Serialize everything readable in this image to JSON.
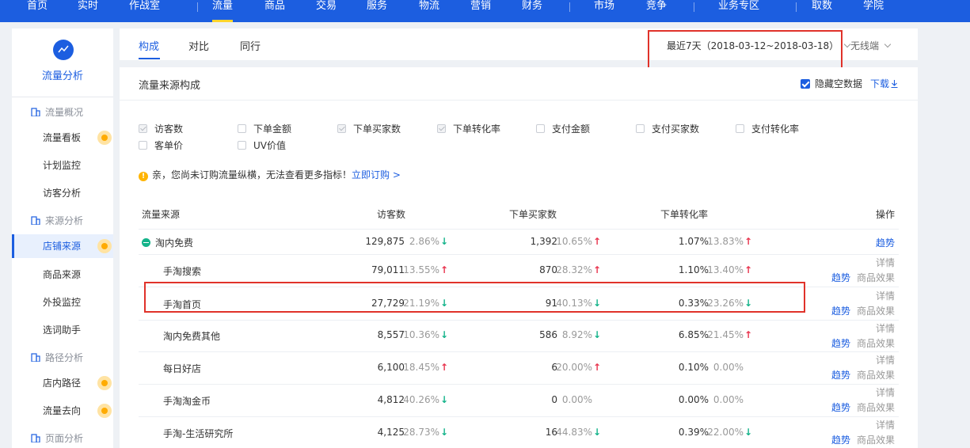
{
  "topnav": {
    "items": [
      "首页",
      "实时",
      "作战室",
      "流量",
      "商品",
      "交易",
      "服务",
      "物流",
      "营销",
      "财务",
      "市场",
      "竞争",
      "业务专区",
      "取数",
      "学院"
    ],
    "active": "流量"
  },
  "sidebar": {
    "title": "流量分析",
    "groups": [
      {
        "label": "流量概况",
        "items": [
          "流量看板",
          "计划监控",
          "访客分析"
        ]
      },
      {
        "label": "来源分析",
        "items": [
          "店铺来源",
          "商品来源",
          "外投监控",
          "选词助手"
        ]
      },
      {
        "label": "路径分析",
        "items": [
          "店内路径",
          "流量去向"
        ]
      },
      {
        "label": "页面分析",
        "items": []
      }
    ],
    "active_item": "店铺来源"
  },
  "tabs": {
    "items": [
      "构成",
      "对比",
      "同行"
    ],
    "active": "构成"
  },
  "date_range": "最近7天（2018-03-12~2018-03-18）",
  "device": "无线端",
  "card": {
    "title": "流量来源构成",
    "hide_empty": "隐藏空数据",
    "download": "下载"
  },
  "metrics": [
    {
      "label": "访客数",
      "state": "disabled-checked"
    },
    {
      "label": "下单金额",
      "state": "unchecked"
    },
    {
      "label": "下单买家数",
      "state": "disabled-checked"
    },
    {
      "label": "下单转化率",
      "state": "disabled-checked"
    },
    {
      "label": "支付金额",
      "state": "unchecked"
    },
    {
      "label": "支付买家数",
      "state": "unchecked"
    },
    {
      "label": "支付转化率",
      "state": "unchecked"
    },
    {
      "label": "客单价",
      "state": "unchecked"
    },
    {
      "label": "UV价值",
      "state": "unchecked"
    }
  ],
  "notice": {
    "text": "亲，您尚未订购流量纵横，无法查看更多指标！",
    "link": "立即订购 >"
  },
  "table": {
    "headers": [
      "流量来源",
      "访客数",
      "下单买家数",
      "下单转化率",
      "操作"
    ],
    "rows": [
      {
        "source": "淘内免费",
        "visitors": "129,875",
        "visitors_pct": "2.86%",
        "visitors_dir": "down",
        "buyers": "1,392",
        "buyers_pct": "10.65%",
        "buyers_dir": "up",
        "conv": "1.07%",
        "conv_pct": "13.83%",
        "conv_dir": "up",
        "ops": [
          "趋势"
        ]
      },
      {
        "source": "手淘搜索",
        "visitors": "79,011",
        "visitors_pct": "13.55%",
        "visitors_dir": "up",
        "buyers": "870",
        "buyers_pct": "28.32%",
        "buyers_dir": "up",
        "conv": "1.10%",
        "conv_pct": "13.40%",
        "conv_dir": "up",
        "ops": [
          "详情",
          "趋势",
          "商品效果"
        ]
      },
      {
        "source": "手淘首页",
        "visitors": "27,729",
        "visitors_pct": "21.19%",
        "visitors_dir": "down",
        "buyers": "91",
        "buyers_pct": "40.13%",
        "buyers_dir": "down",
        "conv": "0.33%",
        "conv_pct": "23.26%",
        "conv_dir": "down",
        "ops": [
          "详情",
          "趋势",
          "商品效果"
        ]
      },
      {
        "source": "淘内免费其他",
        "visitors": "8,557",
        "visitors_pct": "10.36%",
        "visitors_dir": "down",
        "buyers": "586",
        "buyers_pct": "8.92%",
        "buyers_dir": "down",
        "conv": "6.85%",
        "conv_pct": "21.45%",
        "conv_dir": "up",
        "ops": [
          "详情",
          "趋势",
          "商品效果"
        ]
      },
      {
        "source": "每日好店",
        "visitors": "6,100",
        "visitors_pct": "18.45%",
        "visitors_dir": "up",
        "buyers": "6",
        "buyers_pct": "20.00%",
        "buyers_dir": "up",
        "conv": "0.10%",
        "conv_pct": "0.00%",
        "conv_dir": "none",
        "ops": [
          "详情",
          "趋势",
          "商品效果"
        ]
      },
      {
        "source": "手淘淘金币",
        "visitors": "4,812",
        "visitors_pct": "40.26%",
        "visitors_dir": "down",
        "buyers": "0",
        "buyers_pct": "0.00%",
        "buyers_dir": "none",
        "conv": "0.00%",
        "conv_pct": "0.00%",
        "conv_dir": "none",
        "ops": [
          "详情",
          "趋势",
          "商品效果"
        ]
      },
      {
        "source": "手淘-生活研究所",
        "visitors": "4,125",
        "visitors_pct": "28.73%",
        "visitors_dir": "down",
        "buyers": "16",
        "buyers_pct": "44.83%",
        "buyers_dir": "down",
        "conv": "0.39%",
        "conv_pct": "22.00%",
        "conv_dir": "down",
        "ops": [
          "详情",
          "趋势",
          "商品效果"
        ]
      }
    ]
  },
  "colors": {
    "brand": "#1c5ee0",
    "up": "#e8344e",
    "down": "#14b38a",
    "highlight_box": "#e0322a"
  }
}
